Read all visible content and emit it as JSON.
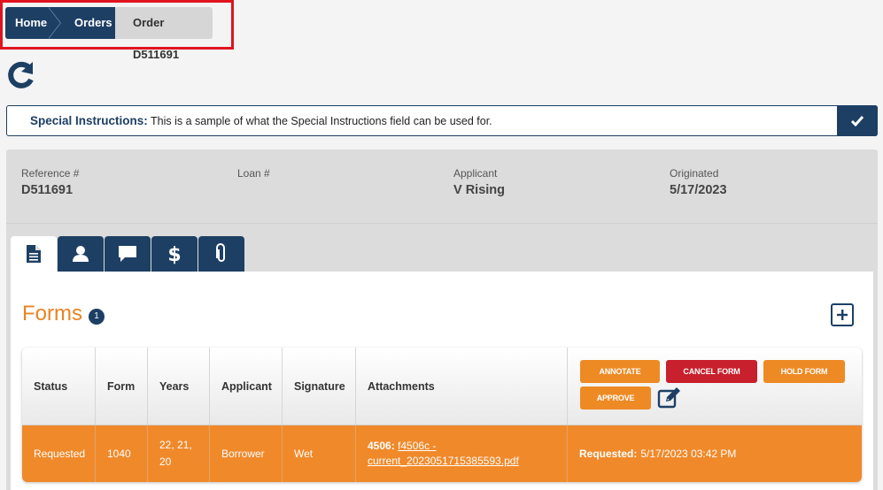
{
  "breadcrumb": {
    "items": [
      {
        "label": "Home"
      },
      {
        "label": "Orders"
      },
      {
        "label": "Order D511691"
      }
    ]
  },
  "special_instructions": {
    "label": "Special Instructions:",
    "text": "This is a sample of what the Special Instructions field can be used for."
  },
  "order_info": {
    "reference_label": "Reference #",
    "reference_value": "D511691",
    "loan_label": "Loan #",
    "loan_value": "",
    "applicant_label": "Applicant",
    "applicant_value": "V Rising",
    "originated_label": "Originated",
    "originated_value": "5/17/2023"
  },
  "tabs": [
    {
      "icon": "document-icon",
      "active": true
    },
    {
      "icon": "user-icon",
      "active": false
    },
    {
      "icon": "comment-icon",
      "active": false
    },
    {
      "icon": "dollar-icon",
      "active": false
    },
    {
      "icon": "paperclip-icon",
      "active": false
    }
  ],
  "forms": {
    "title": "Forms",
    "count": "1",
    "columns": {
      "status": "Status",
      "form": "Form",
      "years": "Years",
      "applicant": "Applicant",
      "signature": "Signature",
      "attachments": "Attachments"
    },
    "actions": {
      "annotate": "ANNOTATE",
      "cancel": "CANCEL FORM",
      "hold": "HOLD FORM",
      "approve": "APPROVE"
    },
    "row": {
      "status": "Requested",
      "form": "1040",
      "years_line1": "22, 21,",
      "years_line2": "20",
      "applicant": "Borrower",
      "signature": "Wet",
      "attachment_prefix": "4506:",
      "attachment_link_line1": "f4506c -",
      "attachment_link_line2": "current_2023051715385593.pdf",
      "requested_label": "Requested:",
      "requested_value": "5/17/2023 03:42 PM"
    }
  },
  "colors": {
    "navy": "#1d3f64",
    "orange": "#f0892a",
    "red": "#c8202c",
    "highlight_border": "#e0141e"
  }
}
